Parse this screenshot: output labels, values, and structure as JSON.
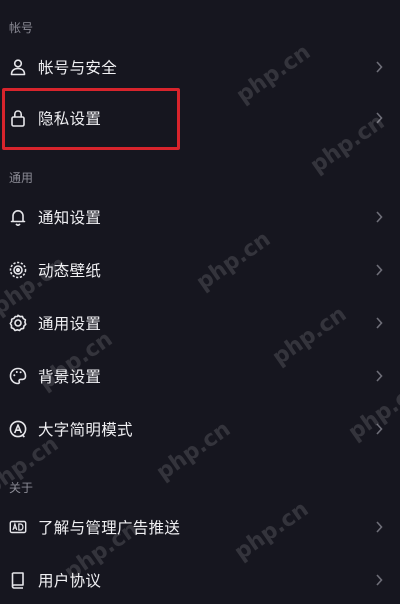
{
  "sections": {
    "account": {
      "header": "帐号"
    },
    "general": {
      "header": "通用"
    },
    "about": {
      "header": "关于"
    }
  },
  "rows": {
    "account_security": {
      "label": "帐号与安全",
      "icon": "person-icon"
    },
    "privacy": {
      "label": "隐私设置",
      "icon": "lock-icon"
    },
    "notifications": {
      "label": "通知设置",
      "icon": "bell-icon"
    },
    "dynamic_wallpaper": {
      "label": "动态壁纸",
      "icon": "wallpaper-icon"
    },
    "general_settings": {
      "label": "通用设置",
      "icon": "gear-icon"
    },
    "background": {
      "label": "背景设置",
      "icon": "palette-icon"
    },
    "large_font": {
      "label": "大字简明模式",
      "icon": "large-text-icon"
    },
    "ads": {
      "label": "了解与管理广告推送",
      "icon": "ad-icon"
    },
    "user_agreement": {
      "label": "用户协议",
      "icon": "book-icon"
    }
  },
  "highlight": {
    "color": "#d8242c",
    "target": "privacy"
  },
  "watermark": {
    "text": "php.cn"
  },
  "colors": {
    "background": "#16161f",
    "text": "#f0f0f3",
    "section_header": "#8a8a94",
    "icon": "#e6e6ea",
    "chevron": "#6e6e78"
  }
}
